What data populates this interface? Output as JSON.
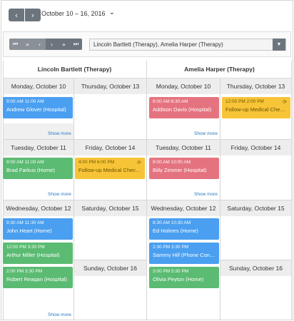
{
  "nav": {
    "prev_icon": "‹",
    "next_icon": "›",
    "date_range": "October 10 – 16, 2016",
    "dropdown_icon": "⌄"
  },
  "resource_nav": {
    "first": "⏮",
    "prev_page": "«",
    "prev": "‹",
    "next": "›",
    "next_page": "»",
    "last": "⏭"
  },
  "resource_select": {
    "value": "Lincoln Bartlett (Therapy), Amelia Harper (Therapy)",
    "caret": "▼"
  },
  "resources": [
    "Lincoln Bartlett (Therapy)",
    "Amelia Harper (Therapy)"
  ],
  "days": {
    "mon": "Monday, October 10",
    "tue": "Tuesday, October 11",
    "wed": "Wednesday, October 12",
    "thu": "Thursday, October 13",
    "fri": "Friday, October 14",
    "sat": "Saturday, October 15",
    "sun": "Sunday, October 16"
  },
  "show_more": "Show more",
  "recurring_icon": "⟳",
  "events": {
    "lb_mon_1": {
      "time": "9:00 AM  11:00 AM",
      "subject": "Andrew Glover (Hospital)"
    },
    "lb_tue_1": {
      "time": "9:00 AM  11:00 AM",
      "subject": "Brad Farkus (Home)"
    },
    "lb_fri_1": {
      "time": "4:00 PM  6:00 PM",
      "subject": "Follow-up Medical Check..."
    },
    "lb_wed_1": {
      "time": "9:30 AM  11:30 AM",
      "subject": "John Heart (Home)"
    },
    "lb_wed_2": {
      "time": "12:00 PM  3:30 PM",
      "subject": "Arthur Miller (Hospital)"
    },
    "lb_wed_3": {
      "time": "2:00 PM  3:30 PM",
      "subject": "Robert Reagan (Hospital)"
    },
    "ah_mon_1": {
      "time": "8:00 AM  8:30 AM",
      "subject": "Addison Davis (Hospital)"
    },
    "ah_thu_1": {
      "time": "12:00 PM  2:00 PM",
      "subject": "Follow-up Medical Check..."
    },
    "ah_tue_1": {
      "time": "8:00 AM  10:00 AM",
      "subject": "Billy Zimmer (Hospital)"
    },
    "ah_wed_1": {
      "time": "8:30 AM  10:30 AM",
      "subject": "Ed Holmes (Home)"
    },
    "ah_wed_2": {
      "time": "2:30 PM  3:30 PM",
      "subject": "Sammy Hill (Phone Cons..."
    },
    "ah_wed_3": {
      "time": "3:00 PM  5:30 PM",
      "subject": "Olivia Peyton (Home)"
    }
  },
  "colors": {
    "blue": "#4a9ff0",
    "red": "#e5737f",
    "green": "#5bbb72",
    "yellow": "#f7c437",
    "button": "#6c757d"
  }
}
